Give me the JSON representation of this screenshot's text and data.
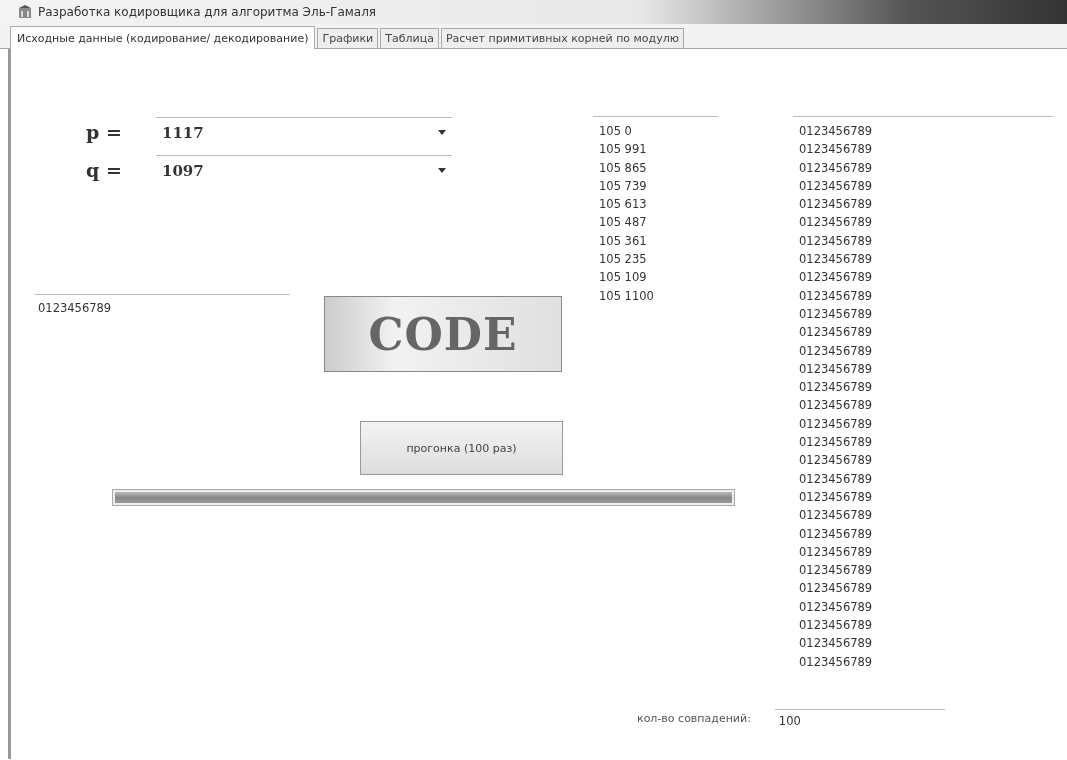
{
  "window": {
    "title": "Разработка кодировщика для алгоритма Эль-Гамаля"
  },
  "tabs": [
    {
      "label": "Исходные данные (кодирование/ декодирование)",
      "selected": true
    },
    {
      "label": "Графики",
      "selected": false
    },
    {
      "label": "Таблица",
      "selected": false
    },
    {
      "label": "Расчет примитивных корней по модулю",
      "selected": false
    }
  ],
  "params": [
    {
      "label": "p =",
      "value": "1117"
    },
    {
      "label": "q =",
      "value": "1097"
    }
  ],
  "message_field": {
    "value": "0123456789"
  },
  "code_button": "CODE",
  "run_button": "прогонка (100 раз)",
  "progress": {
    "level": 1
  },
  "pairs_list": [
    "105 0",
    "105 991",
    "105 865",
    "105 739",
    "105 613",
    "105 487",
    "105 361",
    "105 235",
    "105 109",
    "105 1100"
  ],
  "results_list": [
    "0123456789",
    "0123456789",
    "0123456789",
    "0123456789",
    "0123456789",
    "0123456789",
    "0123456789",
    "0123456789",
    "0123456789",
    "0123456789",
    "0123456789",
    "0123456789",
    "0123456789",
    "0123456789",
    "0123456789",
    "0123456789",
    "0123456789",
    "0123456789",
    "0123456789",
    "0123456789",
    "0123456789",
    "0123456789",
    "0123456789",
    "0123456789",
    "0123456789",
    "0123456789",
    "0123456789",
    "0123456789",
    "0123456789",
    "0123456789"
  ],
  "matches": {
    "label": "кол-во совпадений:",
    "value": "100"
  }
}
